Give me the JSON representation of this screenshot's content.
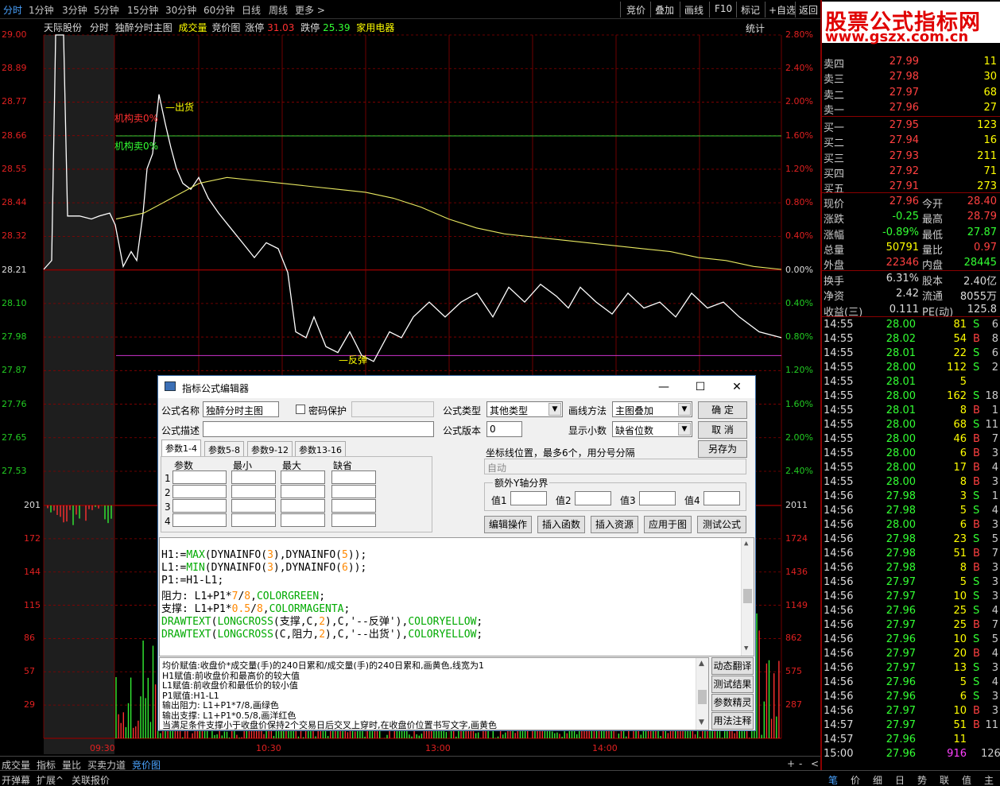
{
  "topbar": {
    "left_tabs": [
      "分时",
      "1分钟",
      "3分钟",
      "5分钟",
      "15分钟",
      "30分钟",
      "60分钟",
      "日线",
      "周线",
      "更多 >"
    ],
    "right_tabs": [
      "竞价",
      "叠加",
      "画线",
      "F10",
      "标记",
      "+自选",
      "返回"
    ]
  },
  "info": {
    "stock": "天际股份",
    "mode": "分时",
    "formula": "独醉分时主图",
    "chengjiao": "成交量",
    "jingjia": "竞价图",
    "zhangting_label": "涨停",
    "zhangting": "31.03",
    "dieting_label": "跌停",
    "dieting": "25.39",
    "sector": "家用电器",
    "tongji": "统计",
    "close": "×"
  },
  "chart_data": {
    "type": "line",
    "title": "",
    "price_axis": [
      "29.00",
      "28.89",
      "28.77",
      "28.66",
      "28.55",
      "28.44",
      "28.32",
      "28.21",
      "28.10",
      "27.98",
      "27.87",
      "27.76",
      "27.65",
      "27.53"
    ],
    "pct_axis": [
      "2.80%",
      "2.40%",
      "2.00%",
      "1.60%",
      "1.20%",
      "0.80%",
      "0.40%",
      "0.00%",
      "0.40%",
      "0.80%",
      "1.20%",
      "1.60%",
      "2.00%",
      "2.40%"
    ],
    "volume_axis_left": [
      "201",
      "172",
      "144",
      "115",
      "86",
      "57",
      "29"
    ],
    "volume_axis_right": [
      "2011",
      "1724",
      "1436",
      "1149",
      "862",
      "575",
      "287"
    ],
    "time_axis": [
      "09:30",
      "10:30",
      "13:00",
      "14:00"
    ],
    "annotations": {
      "jigou_sell_red": "机构卖0%",
      "jigou_sell_green": "机构卖0%",
      "chuhuo": "出货",
      "fantan": "反弹"
    },
    "resistance": 28.66,
    "support": 27.92,
    "prev_close": 28.21,
    "price_series": [
      28.21,
      28.24,
      29.0,
      29.0,
      28.39,
      28.39,
      28.38,
      28.39,
      28.4,
      28.36,
      28.22,
      28.27,
      28.24,
      28.4,
      28.55,
      28.6,
      28.8,
      28.7,
      28.62,
      28.55,
      28.5,
      28.48,
      28.52,
      28.45,
      28.4,
      28.35,
      28.3,
      28.25,
      28.3,
      28.28,
      28.2,
      28.0,
      27.98,
      28.05,
      27.95,
      27.93,
      28.0,
      27.92,
      27.9,
      28.0,
      27.98,
      28.05,
      28.1,
      28.05,
      28.1,
      28.13,
      28.05,
      28.15,
      28.1,
      28.16,
      28.12,
      28.08,
      28.15,
      28.1,
      28.06,
      28.13,
      28.08,
      28.1,
      28.05,
      28.13,
      28.08,
      28.1,
      28.05,
      28.0,
      27.98
    ],
    "avg_series": [
      28.38,
      28.4,
      28.45,
      28.5,
      28.52,
      28.51,
      28.5,
      28.49,
      28.48,
      28.47,
      28.45,
      28.42,
      28.38,
      28.35,
      28.33,
      28.32,
      28.31,
      28.3,
      28.29,
      28.28,
      28.27,
      28.25,
      28.24,
      28.22,
      28.21
    ]
  },
  "volume_counts": {
    "bar_count": 200
  },
  "bottom_nav": [
    "成交量",
    "指标",
    "量比",
    "买卖力道",
    "竞价图"
  ],
  "bottom_right": [
    "+",
    "-",
    "<"
  ],
  "status_bar": [
    "开弹幕",
    "扩展^",
    "关联报价"
  ],
  "status_right": [
    "笔",
    "价",
    "细",
    "日",
    "势",
    "联",
    "值",
    "主"
  ],
  "logo": {
    "line1": "股票公式指标网",
    "line2": "www.gszx.com.cn"
  },
  "orderbook": {
    "sell": [
      {
        "label": "卖四",
        "price": "27.99",
        "vol": "11"
      },
      {
        "label": "卖三",
        "price": "27.98",
        "vol": "30"
      },
      {
        "label": "卖二",
        "price": "27.97",
        "vol": "68"
      },
      {
        "label": "卖一",
        "price": "27.96",
        "vol": "27"
      }
    ],
    "buy": [
      {
        "label": "买一",
        "price": "27.95",
        "vol": "123"
      },
      {
        "label": "买二",
        "price": "27.94",
        "vol": "16"
      },
      {
        "label": "买三",
        "price": "27.93",
        "vol": "211"
      },
      {
        "label": "买四",
        "price": "27.92",
        "vol": "71"
      },
      {
        "label": "买五",
        "price": "27.91",
        "vol": "273"
      }
    ]
  },
  "quote": [
    {
      "l1": "现价",
      "v1": "27.96",
      "l2": "今开",
      "v2": "28.40"
    },
    {
      "l1": "涨跌",
      "v1": "-0.25",
      "l2": "最高",
      "v2": "28.79"
    },
    {
      "l1": "涨幅",
      "v1": "-0.89%",
      "l2": "最低",
      "v2": "27.87"
    },
    {
      "l1": "总量",
      "v1": "50791",
      "l2": "量比",
      "v2": "0.97"
    },
    {
      "l1": "外盘",
      "v1": "22346",
      "l2": "内盘",
      "v2": "28445"
    }
  ],
  "quote2": [
    {
      "l1": "换手",
      "v1": "6.31%",
      "l2": "股本",
      "v2": "2.40亿"
    },
    {
      "l1": "净资",
      "v1": "2.42",
      "l2": "流通",
      "v2": "8055万"
    },
    {
      "l1": "收益(三)",
      "v1": "0.111",
      "l2": "PE(动)",
      "v2": "125.8"
    }
  ],
  "ticks": [
    [
      "14:55",
      "28.00",
      "81",
      "S",
      "6"
    ],
    [
      "14:55",
      "28.02",
      "54",
      "B",
      "8"
    ],
    [
      "14:55",
      "28.01",
      "22",
      "S",
      "6"
    ],
    [
      "14:55",
      "28.00",
      "112",
      "S",
      "2"
    ],
    [
      "14:55",
      "28.01",
      "5",
      "",
      ""
    ],
    [
      "14:55",
      "28.00",
      "162",
      "S",
      "18"
    ],
    [
      "14:55",
      "28.01",
      "8",
      "B",
      "1"
    ],
    [
      "14:55",
      "28.00",
      "68",
      "S",
      "11"
    ],
    [
      "14:55",
      "28.00",
      "46",
      "B",
      "7"
    ],
    [
      "14:55",
      "28.00",
      "6",
      "B",
      "3"
    ],
    [
      "14:55",
      "28.00",
      "17",
      "B",
      "4"
    ],
    [
      "14:55",
      "28.00",
      "8",
      "B",
      "3"
    ],
    [
      "14:56",
      "27.98",
      "3",
      "S",
      "1"
    ],
    [
      "14:56",
      "27.98",
      "5",
      "S",
      "4"
    ],
    [
      "14:56",
      "28.00",
      "6",
      "B",
      "3"
    ],
    [
      "14:56",
      "27.98",
      "23",
      "S",
      "5"
    ],
    [
      "14:56",
      "27.98",
      "51",
      "B",
      "7"
    ],
    [
      "14:56",
      "27.98",
      "8",
      "B",
      "3"
    ],
    [
      "14:56",
      "27.97",
      "5",
      "S",
      "3"
    ],
    [
      "14:56",
      "27.97",
      "10",
      "S",
      "3"
    ],
    [
      "14:56",
      "27.96",
      "25",
      "S",
      "4"
    ],
    [
      "14:56",
      "27.97",
      "25",
      "B",
      "7"
    ],
    [
      "14:56",
      "27.96",
      "10",
      "S",
      "5"
    ],
    [
      "14:56",
      "27.97",
      "20",
      "B",
      "4"
    ],
    [
      "14:56",
      "27.97",
      "13",
      "S",
      "3"
    ],
    [
      "14:56",
      "27.96",
      "5",
      "S",
      "4"
    ],
    [
      "14:56",
      "27.96",
      "6",
      "S",
      "3"
    ],
    [
      "14:56",
      "27.97",
      "10",
      "B",
      "3"
    ],
    [
      "14:57",
      "27.97",
      "51",
      "B",
      "11"
    ],
    [
      "14:57",
      "27.96",
      "11",
      "",
      ""
    ],
    [
      "15:00",
      "27.96",
      "916",
      "",
      "126"
    ]
  ],
  "dialog": {
    "title": "指标公式编辑器",
    "name_label": "公式名称",
    "name_value": "独醉分时主图",
    "pwd_label": "密码保护",
    "type_label": "公式类型",
    "type_value": "其他类型",
    "draw_label": "画线方法",
    "draw_value": "主图叠加",
    "ok": "确  定",
    "desc_label": "公式描述",
    "version_label": "公式版本",
    "version_value": "0",
    "decimal_label": "显示小数",
    "decimal_value": "缺省位数",
    "cancel": "取  消",
    "saveas": "另存为",
    "tabs": [
      "参数1-4",
      "参数5-8",
      "参数9-12",
      "参数13-16"
    ],
    "param_headers": [
      "参数",
      "最小",
      "最大",
      "缺省"
    ],
    "param_rows": [
      "1",
      "2",
      "3",
      "4"
    ],
    "coord_label": "坐标线位置，最多6个，用分号分隔",
    "coord_value": "自动",
    "extra_label": "额外Y轴分界",
    "val_labels": [
      "值1",
      "值2",
      "值3",
      "值4"
    ],
    "buttons": [
      "编辑操作",
      "插入函数",
      "插入资源",
      "应用于图",
      "测试公式"
    ],
    "side_buttons": [
      "动态翻译",
      "测试结果",
      "参数精灵",
      "用法注释"
    ],
    "code": {
      "l1a": "H1:=",
      "l1b": "MAX",
      "l1c": "(DYNAINFO(",
      "l1d": "3",
      "l1e": "),DYNAINFO(",
      "l1f": "5",
      "l1g": "));",
      "l2a": "L1:=",
      "l2b": "MIN",
      "l2c": "(DYNAINFO(",
      "l2d": "3",
      "l2e": "),DYNAINFO(",
      "l2f": "6",
      "l2g": "));",
      "l3": "P1:=H1-L1;",
      "l4a": "阻力: L1+P1*",
      "l4b": "7",
      "l4c": "/",
      "l4d": "8",
      "l4e": ",",
      "l4f": "COLORGREEN",
      "l4g": ";",
      "l5a": "支撑: L1+P1*",
      "l5b": "0.5",
      "l5c": "/",
      "l5d": "8",
      "l5e": ",",
      "l5f": "COLORMAGENTA",
      "l5g": ";",
      "l6a": "DRAWTEXT",
      "l6b": "(",
      "l6c": "LONGCROSS",
      "l6d": "(支撑,C,",
      "l6e": "2",
      "l6f": "),C,'--反弹'),",
      "l6g": "COLORYELLOW",
      "l6h": ";",
      "l7a": "DRAWTEXT",
      "l7b": "(",
      "l7c": "LONGCROSS",
      "l7d": "(C,阻力,",
      "l7e": "2",
      "l7f": "),C,'--出货'),",
      "l7g": "COLORYELLOW",
      "l7h": ";"
    },
    "desc_lines": [
      "均价赋值:收盘价*成交量(手)的240日累和/成交量(手)的240日累和,画黄色,线宽为1",
      "H1赋值:前收盘价和最高价的较大值",
      "L1赋值:前收盘价和最低价的较小值",
      "P1赋值:H1-L1",
      "输出阻力: L1+P1*7/8,画绿色",
      "输出支撑: L1+P1*0.5/8,画洋红色",
      "当满足条件支撑小于收盘价保持2个交易日后交叉上穿时,在收盘价位置书写文字,画黄色"
    ]
  }
}
